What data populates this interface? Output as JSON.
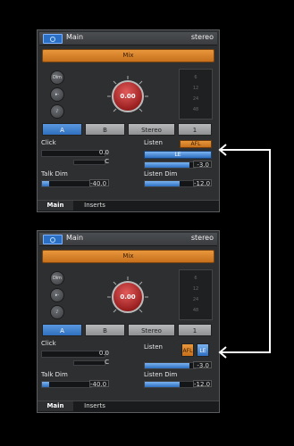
{
  "panel_top": {
    "title": "Main",
    "channel": "stereo",
    "mix": "Mix",
    "side_buttons": [
      "Dim",
      "",
      ""
    ],
    "knob_value": "0.00",
    "meter_ticks": [
      "6",
      "12",
      "24",
      "48"
    ],
    "tabs": [
      "A",
      "B",
      "Stereo",
      "1"
    ],
    "click_label": "Click",
    "click_value": "0.0",
    "click_pan": "C",
    "talkdim_label": "Talk Dim",
    "talkdim_value": "-40.0",
    "listen_label": "Listen",
    "afl_label": "AFL",
    "le_label": "LE",
    "listen_value": "-3.0",
    "listendim_label": "Listen Dim",
    "listendim_value": "-12.0",
    "bottom_tabs": [
      "Main",
      "Inserts"
    ]
  },
  "panel_bottom": {
    "title": "Main",
    "channel": "stereo",
    "mix": "Mix",
    "side_buttons": [
      "Dim",
      "",
      ""
    ],
    "knob_value": "0.00",
    "meter_ticks": [
      "6",
      "12",
      "24",
      "48"
    ],
    "tabs": [
      "A",
      "B",
      "Stereo",
      "1"
    ],
    "click_label": "Click",
    "click_value": "0.0",
    "click_pan": "C",
    "talkdim_label": "Talk Dim",
    "talkdim_value": "-40.0",
    "listen_label": "Listen",
    "afl_label": "AFL",
    "le_label": "LE",
    "listen_value": "-3.0",
    "listendim_label": "Listen Dim",
    "listendim_value": "-12.0",
    "bottom_tabs": [
      "Main",
      "Inserts"
    ]
  },
  "colors": {
    "accent_orange": "#d98330",
    "accent_blue": "#3b7fd0",
    "knob_red": "#b42a2a"
  }
}
